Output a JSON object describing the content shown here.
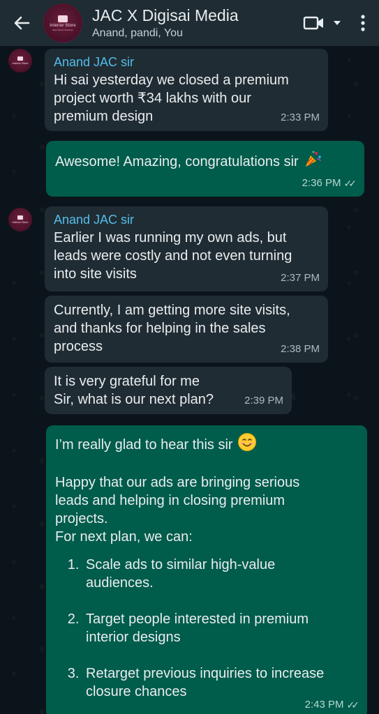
{
  "header": {
    "title": "JAC X Digisai Media",
    "participants": "Anand, pandi, You",
    "avatar_text": "Interior Store",
    "avatar_subtext": "Best Interior Solutions",
    "icons": [
      "back-arrow-icon",
      "video-call-icon",
      "dropdown-caret-icon",
      "more-vertical-icon"
    ]
  },
  "messages": [
    {
      "direction": "incoming",
      "sender": "Anand JAC sir",
      "text": "Hi sai yesterday we closed a premium\nproject worth ₹34 lakhs with our\npremium design",
      "time": "2:33 PM"
    },
    {
      "direction": "outgoing",
      "text": "Awesome! Amazing, congratulations sir",
      "emoji": "party-popper",
      "time": "2:36 PM",
      "status": "read"
    },
    {
      "direction": "incoming",
      "sender": "Anand JAC sir",
      "text": "Earlier I was running my own ads, but\nleads were costly and not even turning\ninto site visits",
      "time": "2:37 PM"
    },
    {
      "direction": "incoming",
      "text": "Currently, I am getting more site visits,\nand thanks for helping in the sales\nprocess",
      "time": "2:38 PM"
    },
    {
      "direction": "incoming",
      "text": "It is very grateful for me\nSir, what is our next plan?",
      "time": "2:39 PM"
    },
    {
      "direction": "outgoing",
      "intro": "I’m really glad to hear this sir",
      "emoji": "smiling-face",
      "body": "Happy that our ads are bringing serious\nleads and helping in closing premium\nprojects.\nFor next plan, we can:",
      "points": [
        "Scale ads to similar high-value\naudiences.",
        "Target people interested in premium\ninterior designs",
        "Retarget previous inquiries to increase\nclosure chances"
      ],
      "time": "2:43 PM",
      "status": "read"
    }
  ],
  "colors": {
    "header_bg": "#1f2c33",
    "chat_bg": "#0b141a",
    "incoming_bubble": "#202c33",
    "outgoing_bubble": "#005c4b",
    "sender_name": "#53bdeb"
  }
}
